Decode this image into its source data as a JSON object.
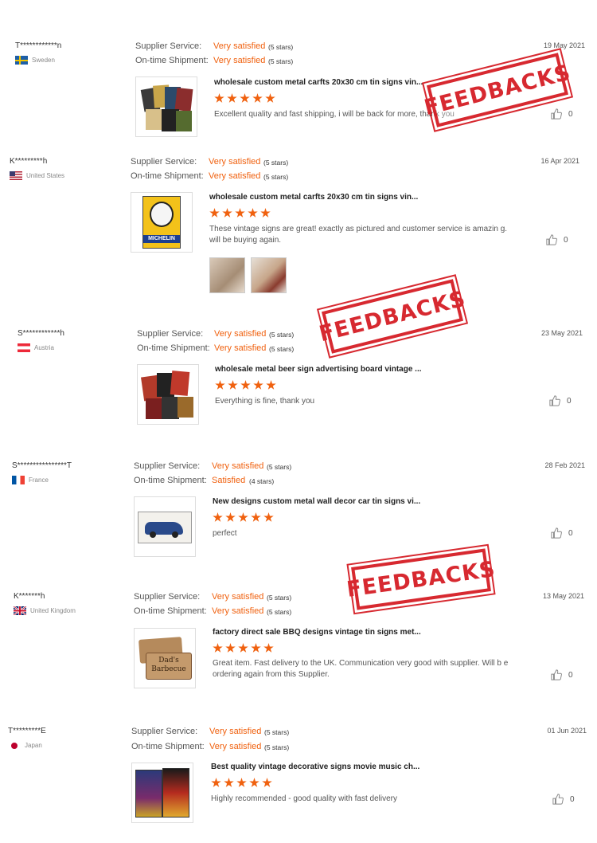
{
  "labels": {
    "supplier": "Supplier Service:",
    "shipment": "On-time Shipment:"
  },
  "stamp_text": "FEEDBACKS",
  "colors": {
    "accent": "#f0610f",
    "stamp": "#d4171f"
  },
  "reviews": [
    {
      "user": "T************n",
      "country": "Sweden",
      "flag": "sweden",
      "supplier": "Very satisfied",
      "supplier_stars": "(5 stars)",
      "shipment": "Very satisfied",
      "shipment_stars": "(5 stars)",
      "date": "19 May 2021",
      "title": "wholesale custom metal carfts 20x30 cm tin signs vin...",
      "comment": "Excellent quality and fast shipping, i will be back for more, thank you",
      "likes": "0",
      "rating": 5
    },
    {
      "user": "K*********h",
      "country": "United States",
      "flag": "usa",
      "supplier": "Very satisfied",
      "supplier_stars": "(5 stars)",
      "shipment": "Very satisfied",
      "shipment_stars": "(5 stars)",
      "date": "16 Apr 2021",
      "title": "wholesale custom metal carfts 20x30 cm tin signs vin...",
      "comment": "These vintage signs are great! exactly as pictured and customer service is amazin g. will be buying again.",
      "likes": "0",
      "rating": 5,
      "thumb_text": "MICHELIN"
    },
    {
      "user": "S************h",
      "country": "Austria",
      "flag": "austria",
      "supplier": "Very satisfied",
      "supplier_stars": "(5 stars)",
      "shipment": "Very satisfied",
      "shipment_stars": "(5 stars)",
      "date": "23 May 2021",
      "title": "wholesale metal beer sign advertising board vintage ...",
      "comment": "Everything is fine, thank you",
      "likes": "0",
      "rating": 5
    },
    {
      "user": "S****************T",
      "country": "France",
      "flag": "france",
      "supplier": "Very satisfied",
      "supplier_stars": "(5 stars)",
      "shipment": "Satisfied",
      "shipment_stars": "(4 stars)",
      "date": "28 Feb 2021",
      "title": "New designs custom metal wall decor car tin signs vi...",
      "comment": "perfect",
      "likes": "0",
      "rating": 5
    },
    {
      "user": "K*******h",
      "country": "United Kingdom",
      "flag": "uk",
      "supplier": "Very satisfied",
      "supplier_stars": "(5 stars)",
      "shipment": "Very satisfied",
      "shipment_stars": "(5 stars)",
      "date": "13 May 2021",
      "title": "factory direct sale BBQ designs vintage tin signs met...",
      "comment": "Great item. Fast delivery to the UK. Communication very good with supplier. Will b e ordering again from this Supplier.",
      "likes": "0",
      "rating": 5,
      "thumb_text": "Dad's Barbecue"
    },
    {
      "user": "T*********E",
      "country": "Japan",
      "flag": "japan",
      "supplier": "Very satisfied",
      "supplier_stars": "(5 stars)",
      "shipment": "Very satisfied",
      "shipment_stars": "(5 stars)",
      "date": "01 Jun 2021",
      "title": "Best quality vintage decorative signs movie music ch...",
      "comment": "Highly recommended - good quality with fast delivery",
      "likes": "0",
      "rating": 5
    }
  ]
}
